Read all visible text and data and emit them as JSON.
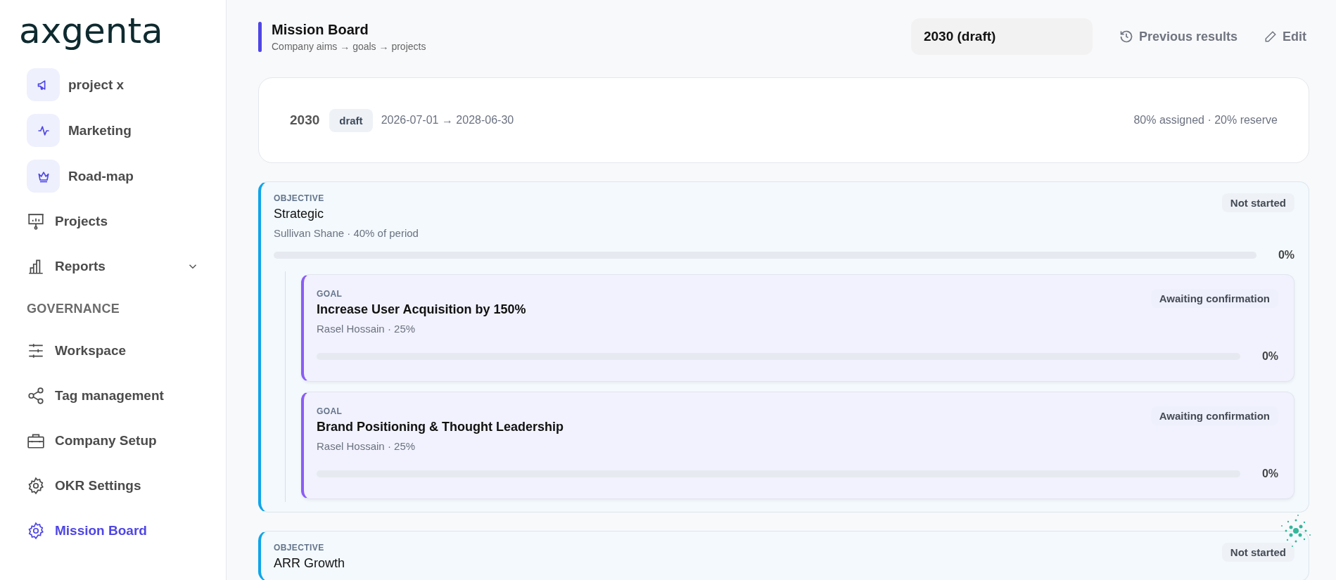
{
  "sidebar": {
    "logo": "axgenta",
    "items": [
      {
        "kind": "project",
        "label": "project x",
        "selected": false
      },
      {
        "kind": "project",
        "label": "Marketing",
        "selected": false
      },
      {
        "kind": "project",
        "label": "Road-map",
        "selected": false
      },
      {
        "kind": "nav",
        "label": "Projects",
        "selected": false
      },
      {
        "kind": "nav",
        "label": "Reports",
        "selected": false,
        "expanded": false
      },
      {
        "kind": "section",
        "label": "GOVERNANCE"
      },
      {
        "kind": "nav",
        "label": "Workspace",
        "selected": false
      },
      {
        "kind": "nav",
        "label": "Tag management",
        "selected": false
      },
      {
        "kind": "nav",
        "label": "Company Setup",
        "selected": false
      },
      {
        "kind": "nav",
        "label": "OKR Settings",
        "selected": false
      },
      {
        "kind": "nav",
        "label": "Mission Board",
        "selected": true
      }
    ]
  },
  "header": {
    "title": "Mission Board",
    "subtitle": "Company aims → goals → projects",
    "period_select": "2030 (draft)",
    "buttons": [
      "Previous results",
      "Edit"
    ]
  },
  "period": {
    "year": "2030",
    "badge": "draft",
    "dates": "2026-07-01 → 2028-06-30",
    "allocation": "80% assigned · 20% reserve"
  },
  "objectives": [
    {
      "label": "OBJECTIVE",
      "title": "Strategic",
      "meta": "Sullivan Shane · 40% of period",
      "status": "Not started",
      "level": 0,
      "progress": "0%",
      "goals": [
        {
          "label": "GOAL",
          "title": "Increase User Acquisition by 150%",
          "meta": "Rasel Hossain · 25%",
          "status": "Awaiting confirmation",
          "level": 0,
          "progress": "0%"
        },
        {
          "label": "GOAL",
          "title": "Brand Positioning & Thought Leadership",
          "meta": "Rasel Hossain · 25%",
          "status": "Awaiting confirmation",
          "level": 0,
          "progress": "0%"
        }
      ]
    },
    {
      "label": "OBJECTIVE",
      "title": "ARR Growth",
      "status": "Not started"
    }
  ]
}
